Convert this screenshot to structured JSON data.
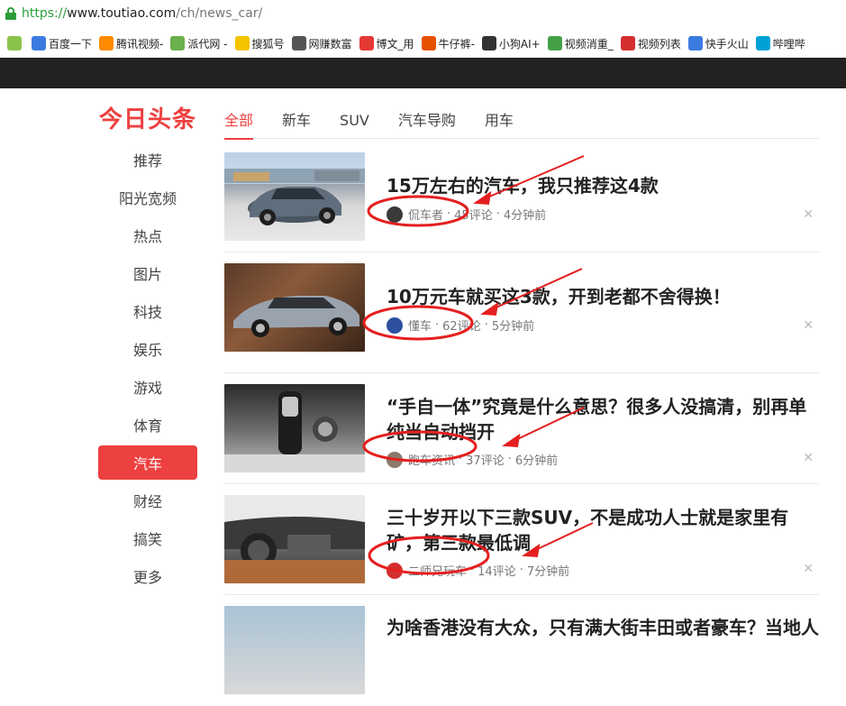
{
  "browser": {
    "url_scheme": "https://",
    "url_host": "www.toutiao.com",
    "url_path": "/ch/news_car/",
    "bookmarks": [
      {
        "label": "",
        "icon": "hao-icon",
        "color": "#8bc34a"
      },
      {
        "label": "百度一下",
        "icon": "baidu-paw-icon",
        "color": "#3b7be0"
      },
      {
        "label": "腾讯视频-",
        "icon": "tencent-video-icon",
        "color": "#ff8a00"
      },
      {
        "label": "派代网 -",
        "icon": "paidai-icon",
        "color": "#6ab04c"
      },
      {
        "label": "搜狐号",
        "icon": "sohu-icon",
        "color": "#f5c400"
      },
      {
        "label": "网赚数富",
        "icon": "headphone-icon",
        "color": "#555555"
      },
      {
        "label": "博文_用",
        "icon": "bowen-icon",
        "color": "#e53935"
      },
      {
        "label": "牛仔裤-",
        "icon": "jeans-icon",
        "color": "#e65100"
      },
      {
        "label": "小狗AI+",
        "icon": "dog-icon",
        "color": "#333333"
      },
      {
        "label": "视频消重_",
        "icon": "play-circle-icon",
        "color": "#43a047"
      },
      {
        "label": "视频列表",
        "icon": "play-circle-red-icon",
        "color": "#d32f2f"
      },
      {
        "label": "快手火山",
        "icon": "paw-icon",
        "color": "#3b7be0"
      },
      {
        "label": "哔哩哔",
        "icon": "bilibili-icon",
        "color": "#00a1d6"
      }
    ]
  },
  "brand": {
    "logo": "今日头条",
    "accent": "#ed4040"
  },
  "sidenav": [
    "推荐",
    "阳光宽频",
    "热点",
    "图片",
    "科技",
    "娱乐",
    "游戏",
    "体育",
    "汽车",
    "财经",
    "搞笑",
    "更多"
  ],
  "sidenav_active": "汽车",
  "tabs": [
    "全部",
    "新车",
    "SUV",
    "汽车导购",
    "用车"
  ],
  "tabs_active": "全部",
  "articles": [
    {
      "title": "15万左右的汽车，我只推荐这4款",
      "author": "侃车者",
      "comments": "45评论",
      "time": "4分钟前"
    },
    {
      "title": "10万元车就买这3款，开到老都不舍得换！",
      "author": "懂车",
      "comments": "62评论",
      "time": "5分钟前"
    },
    {
      "title": "“手自一体”究竟是什么意思？很多人没搞清，别再单纯当自动挡开",
      "author": "跑车资讯",
      "comments": "37评论",
      "time": "6分钟前"
    },
    {
      "title": "三十岁开以下三款SUV，不是成功人士就是家里有矿，第三款最低调",
      "author": "二师兄玩车",
      "comments": "14评论",
      "time": "7分钟前"
    },
    {
      "title": "为啥香港没有大众，只有满大街丰田或者豪车？当地人"
    }
  ],
  "separator": "·",
  "close_glyph": "✕"
}
